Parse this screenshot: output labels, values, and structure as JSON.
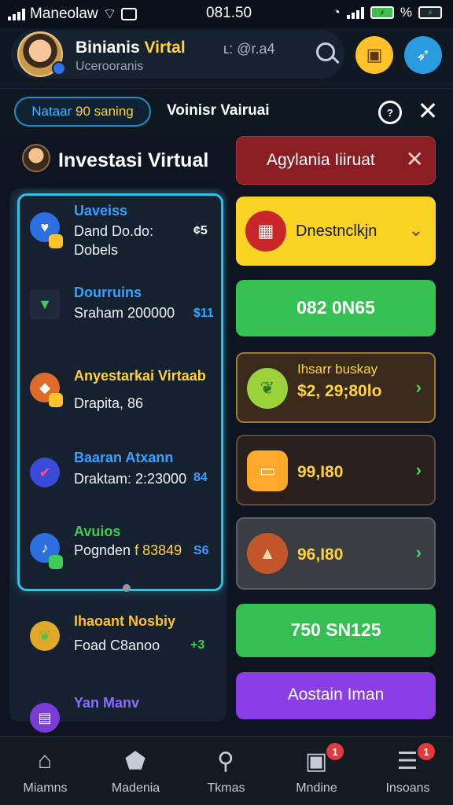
{
  "status_bar": {
    "carrier": "Maneolaw",
    "time": "081.50",
    "battery": "%"
  },
  "header": {
    "name_part1": "Binianis",
    "name_part2": "Virtal",
    "handle": "ʟ: @r.a4",
    "subtitle": "Ucerooranis"
  },
  "tab_row": {
    "pill_part1": "Nataar",
    "pill_part2": "90 saning",
    "title": "Voinisr Vairuai"
  },
  "section": {
    "title": "Investasi Virtual",
    "red_bar_label": "Agylania Iiiruat"
  },
  "left_list": [
    {
      "title": "Uaveiss",
      "title_color": "#3aa0ff",
      "sub1": "Dand Do.do:",
      "sub2": "Dobels",
      "value": "¢5"
    },
    {
      "title": "Dourruins",
      "title_color": "#3aa0ff",
      "sub1": "Sraham 200000",
      "value": "$11"
    },
    {
      "title": "Anyestarkai Virtaab",
      "title_color": "#ffd23a",
      "sub1": "Drapita, 86"
    },
    {
      "title": "Baaran Atxann",
      "title_color": "#3aa0ff",
      "sub1": "Draktam: 2:23000",
      "value": "84"
    },
    {
      "title": "Avuios",
      "title_color": "#3dcc56",
      "sub1_prefix": "Pognden",
      "sub1_highlight": "f 83849",
      "value": "S6"
    },
    {
      "title": "Ihaoant Nosbiy",
      "title_color": "#ffc22c",
      "sub1": "Foad C8anoo",
      "value": "+3"
    },
    {
      "title": "Yan Manv",
      "title_color": "#8a6cff"
    }
  ],
  "cards": {
    "yellow_label": "Dnestnclkjn",
    "green1_value": "082 0N65",
    "brown_title": "Ihsarr buskay",
    "brown_value": "$2, 29;80lo",
    "dark_value": "99,I80",
    "gray_value": "96,I80",
    "green2_value": "750 SN125",
    "purple_label": "Aostain Iman"
  },
  "bottom_nav": [
    {
      "label": "Miamns"
    },
    {
      "label": "Madenia"
    },
    {
      "label": "Tkmas"
    },
    {
      "label": "Mndine",
      "badge": "1"
    },
    {
      "label": "Insoans",
      "badge": "1"
    }
  ]
}
